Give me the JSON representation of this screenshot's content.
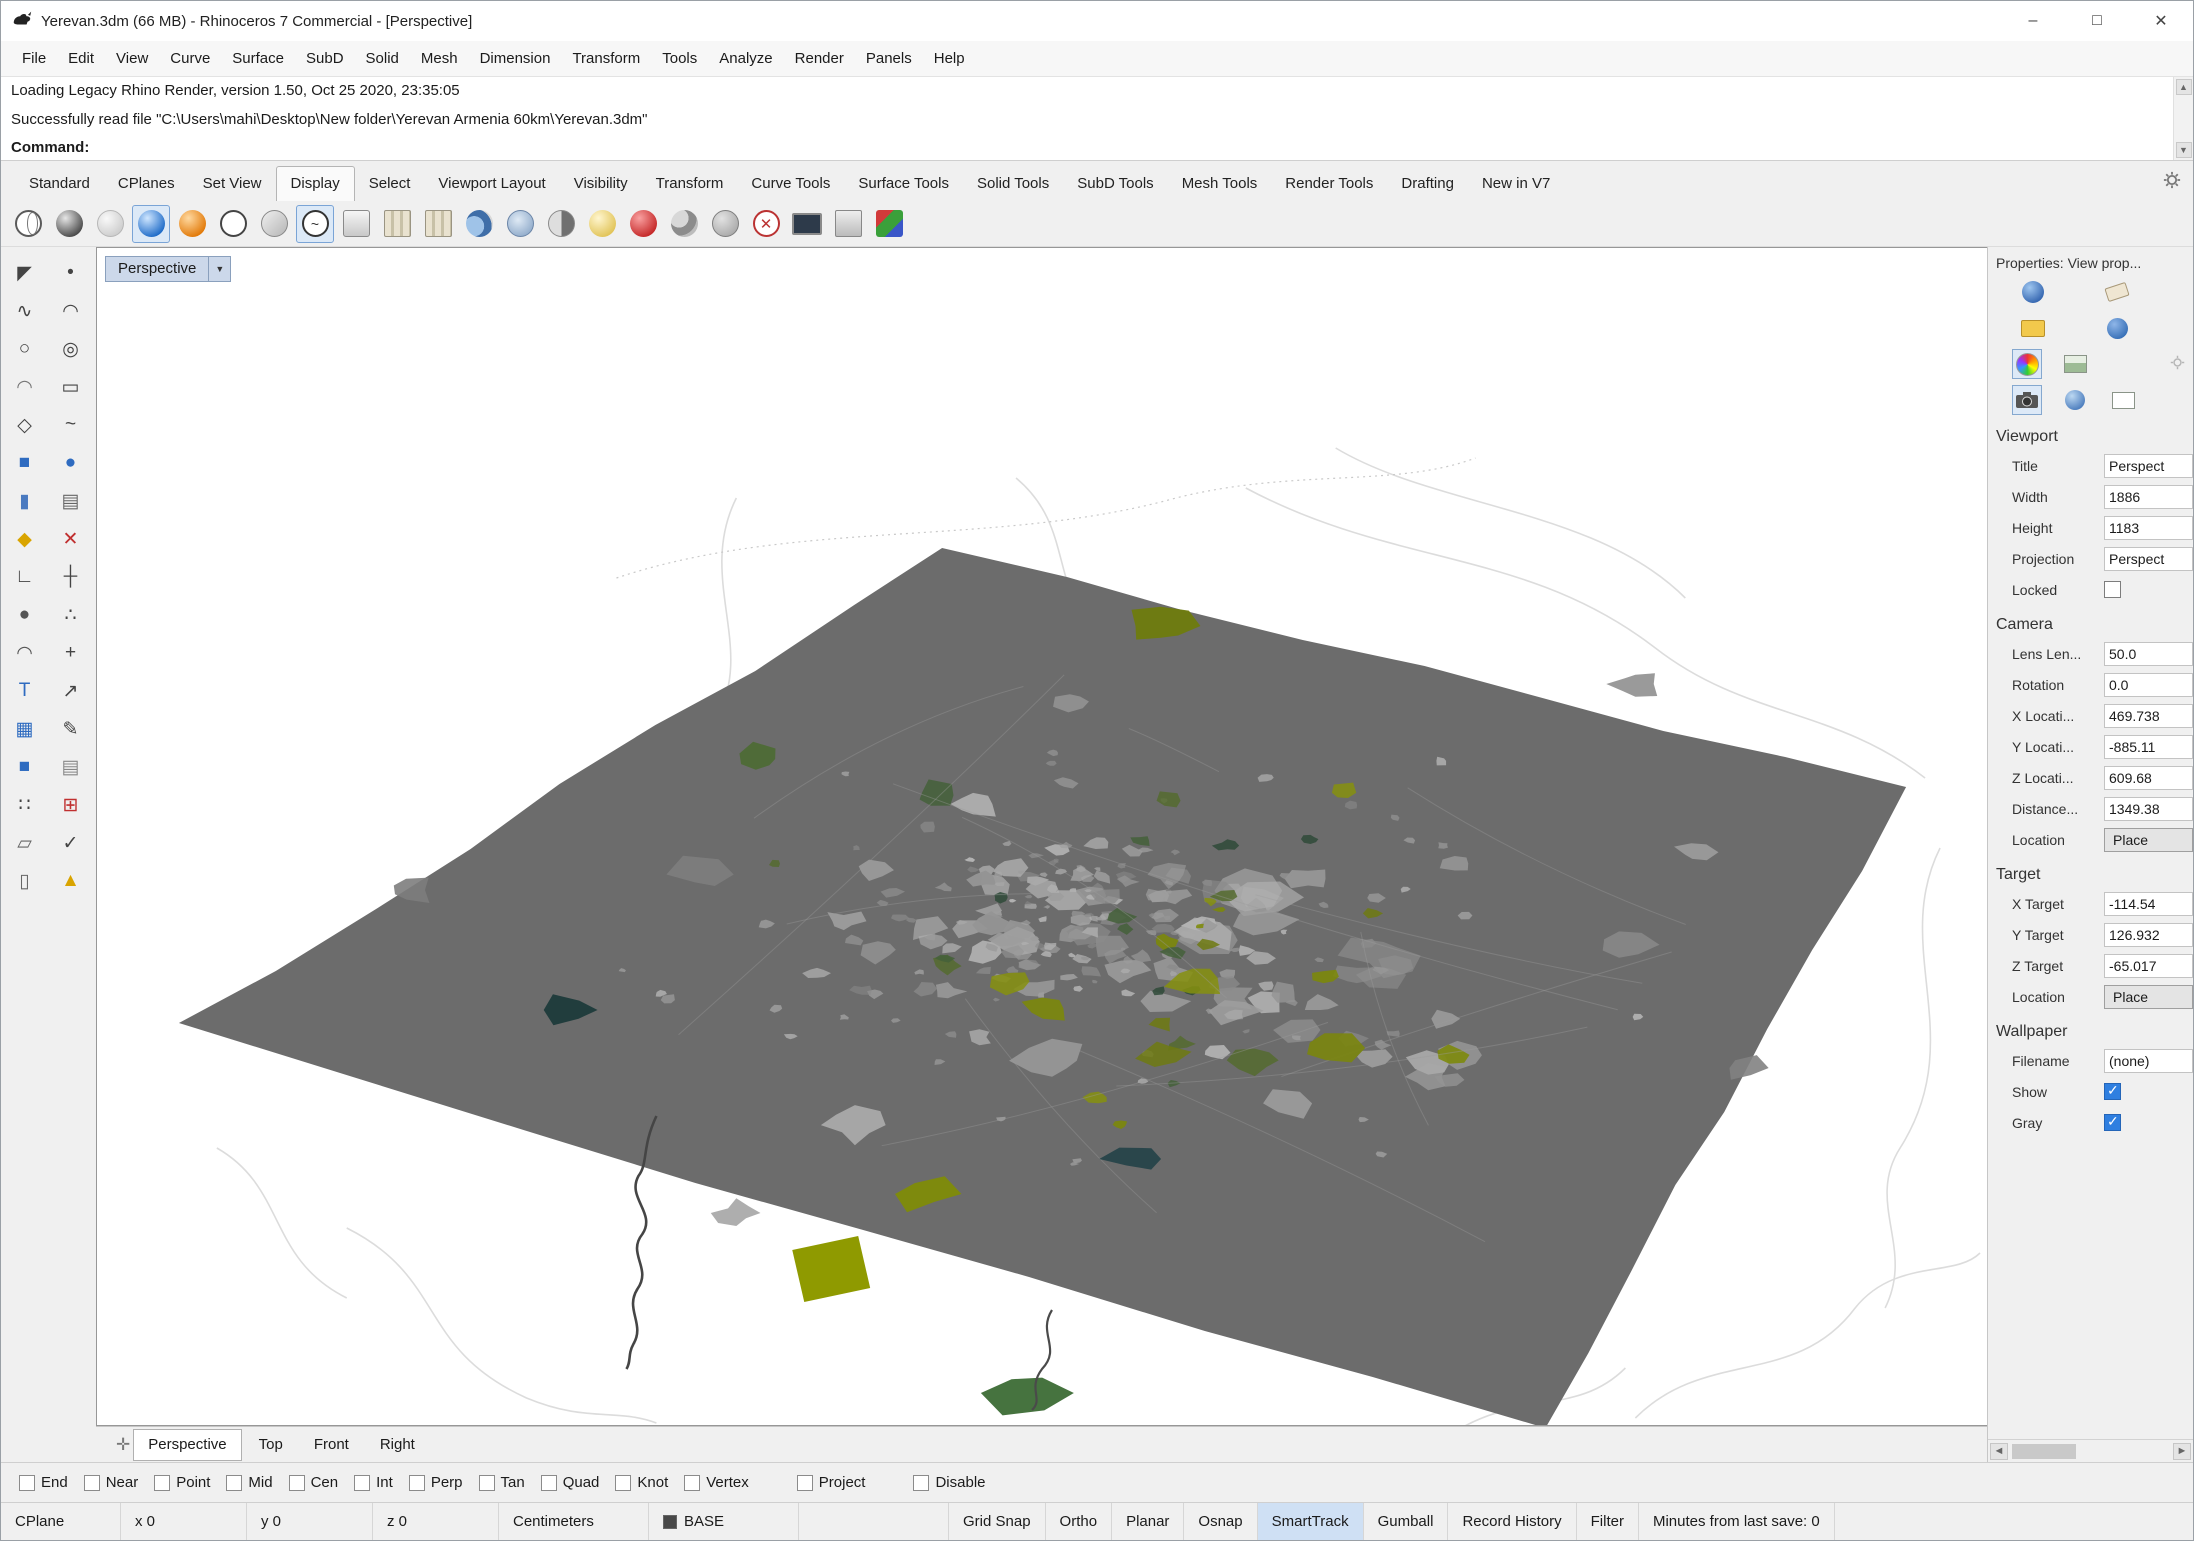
{
  "window": {
    "title": "Yerevan.3dm (66 MB) - Rhinoceros 7 Commercial - [Perspective]"
  },
  "menu": {
    "items": [
      "File",
      "Edit",
      "View",
      "Curve",
      "Surface",
      "SubD",
      "Solid",
      "Mesh",
      "Dimension",
      "Transform",
      "Tools",
      "Analyze",
      "Render",
      "Panels",
      "Help"
    ]
  },
  "command": {
    "line1": "Loading Legacy Rhino Render, version 1.50, Oct 25 2020, 23:35:05",
    "line2": "Successfully read file \"C:\\Users\\mahi\\Desktop\\New folder\\Yerevan Armenia 60km\\Yerevan.3dm\"",
    "prompt": "Command:"
  },
  "tabs": {
    "items": [
      "Standard",
      "CPlanes",
      "Set View",
      "Display",
      "Select",
      "Viewport Layout",
      "Visibility",
      "Transform",
      "Curve Tools",
      "Surface Tools",
      "Solid Tools",
      "SubD Tools",
      "Mesh Tools",
      "Render Tools",
      "Drafting",
      "New in V7"
    ],
    "active": "Display"
  },
  "display_toolbar": {
    "icons": [
      {
        "name": "wireframe-mode-icon",
        "kind": "k-wire"
      },
      {
        "name": "shaded-mode-icon",
        "kind": "k-shaded"
      },
      {
        "name": "ghosted-mode-icon",
        "kind": "k-ghosted"
      },
      {
        "name": "rendered-mode-icon",
        "kind": "k-rendered",
        "pressed": true
      },
      {
        "name": "raytraced-mode-icon",
        "kind": "k-raytraced"
      },
      {
        "name": "technical-mode-icon",
        "kind": "k-technical"
      },
      {
        "name": "artistic-mode-icon",
        "kind": "k-artistic"
      },
      {
        "name": "pen-mode-icon",
        "kind": "k-pen",
        "pressed": true
      },
      {
        "name": "arctic-mode-icon",
        "kind": "k-box"
      },
      {
        "name": "package-display-icon",
        "kind": "k-package"
      },
      {
        "name": "package-alt-display-icon",
        "kind": "k-package"
      },
      {
        "name": "rotate-view-icon",
        "kind": "k-duo"
      },
      {
        "name": "globe-grid-icon",
        "kind": "k-globe"
      },
      {
        "name": "half-shade-icon",
        "kind": "k-half"
      },
      {
        "name": "cream-sphere-icon",
        "kind": "k-cream"
      },
      {
        "name": "clipping-plane-icon",
        "kind": "k-clip"
      },
      {
        "name": "twin-spheres-icon",
        "kind": "k-twin"
      },
      {
        "name": "sphere-arrow-icon",
        "kind": "k-arrow"
      },
      {
        "name": "disable-clipping-icon",
        "kind": "k-xmark"
      },
      {
        "name": "fullscreen-display-icon",
        "kind": "k-monitor"
      },
      {
        "name": "boxes-display-icon",
        "kind": "k-boxes"
      },
      {
        "name": "rgb-cube-icon",
        "kind": "k-rgb"
      }
    ]
  },
  "left_toolbar": {
    "tools": [
      {
        "name": "pointer-tool-icon",
        "glyph": "◤",
        "color": "#444"
      },
      {
        "name": "point-tool-icon",
        "glyph": "•",
        "color": "#444"
      },
      {
        "name": "polyline-tool-icon",
        "glyph": "∿",
        "color": "#444"
      },
      {
        "name": "curve-tool-icon",
        "glyph": "◠",
        "color": "#444"
      },
      {
        "name": "circle-tool-icon",
        "glyph": "○",
        "color": "#444"
      },
      {
        "name": "ellipse-tool-icon",
        "glyph": "◎",
        "color": "#444"
      },
      {
        "name": "arc-tool-icon",
        "glyph": "◠",
        "color": "#777"
      },
      {
        "name": "rectangle-tool-icon",
        "glyph": "▭",
        "color": "#444"
      },
      {
        "name": "polygon-tool-icon",
        "glyph": "◇",
        "color": "#444"
      },
      {
        "name": "freeform-curve-tool-icon",
        "glyph": "~",
        "color": "#444"
      },
      {
        "name": "box-tool-icon",
        "glyph": "■",
        "color": "#2e6bc0"
      },
      {
        "name": "sphere-tool-icon",
        "glyph": "●",
        "color": "#2e6bc0"
      },
      {
        "name": "cylinder-tool-icon",
        "glyph": "▮",
        "color": "#4a7ac0"
      },
      {
        "name": "extrude-tool-icon",
        "glyph": "▤",
        "color": "#666"
      },
      {
        "name": "boolean-tool-icon",
        "glyph": "◆",
        "color": "#d9a400"
      },
      {
        "name": "trim-tool-icon",
        "glyph": "✕",
        "color": "#c03030"
      },
      {
        "name": "orient-tool-icon",
        "glyph": "∟",
        "color": "#444"
      },
      {
        "name": "align-tool-icon",
        "glyph": "┼",
        "color": "#444"
      },
      {
        "name": "shaded-sphere-tool-icon",
        "glyph": "●",
        "color": "#555"
      },
      {
        "name": "point-cloud-tool-icon",
        "glyph": "∴",
        "color": "#444"
      },
      {
        "name": "curve-edit-tool-icon",
        "glyph": "◠",
        "color": "#555"
      },
      {
        "name": "move-tool-icon",
        "glyph": "+",
        "color": "#444"
      },
      {
        "name": "text-tool-icon",
        "glyph": "T",
        "color": "#2e6bc0"
      },
      {
        "name": "scale-tool-icon",
        "glyph": "↗",
        "color": "#444"
      },
      {
        "name": "hatch-tool-icon",
        "glyph": "▦",
        "color": "#2e6bc0"
      },
      {
        "name": "annotate-tool-icon",
        "glyph": "✎",
        "color": "#444"
      },
      {
        "name": "solid-box-tool-icon",
        "glyph": "■",
        "color": "#2e6bc0"
      },
      {
        "name": "surface-tool-icon",
        "glyph": "▤",
        "color": "#888"
      },
      {
        "name": "grid-points-tool-icon",
        "glyph": "∷",
        "color": "#444"
      },
      {
        "name": "grid-tool-icon",
        "glyph": "⊞",
        "color": "#c03030"
      },
      {
        "name": "plane-tool-icon",
        "glyph": "▱",
        "color": "#666"
      },
      {
        "name": "check-tool-icon",
        "glyph": "✓",
        "color": "#444"
      },
      {
        "name": "tube-tool-icon",
        "glyph": "▯",
        "color": "#666"
      },
      {
        "name": "cone-tool-icon",
        "glyph": "▲",
        "color": "#d9a400"
      }
    ]
  },
  "viewport": {
    "title_label": "Perspective"
  },
  "viewport_tabs": {
    "items": [
      "Perspective",
      "Top",
      "Front",
      "Right"
    ],
    "active": "Perspective"
  },
  "props": {
    "header": "Properties: View prop...",
    "viewport_section": {
      "title": "Viewport",
      "rows": [
        {
          "label": "Title",
          "value": "Perspect"
        },
        {
          "label": "Width",
          "value": "1886"
        },
        {
          "label": "Height",
          "value": "1183"
        },
        {
          "label": "Projection",
          "value": "Perspect"
        },
        {
          "label": "Locked",
          "value": "",
          "checked": false
        }
      ]
    },
    "camera_section": {
      "title": "Camera",
      "rows": [
        {
          "label": "Lens Len...",
          "value": "50.0"
        },
        {
          "label": "Rotation",
          "value": "0.0"
        },
        {
          "label": "X Locati...",
          "value": "469.738"
        },
        {
          "label": "Y Locati...",
          "value": "-885.11"
        },
        {
          "label": "Z Locati...",
          "value": "609.68"
        },
        {
          "label": "Distance...",
          "value": "1349.38"
        },
        {
          "label": "Location",
          "value": "Place"
        }
      ]
    },
    "target_section": {
      "title": "Target",
      "rows": [
        {
          "label": "X Target",
          "value": "-114.54"
        },
        {
          "label": "Y Target",
          "value": "126.932"
        },
        {
          "label": "Z Target",
          "value": "-65.017"
        },
        {
          "label": "Location",
          "value": "Place"
        }
      ]
    },
    "wallpaper_section": {
      "title": "Wallpaper",
      "rows": [
        {
          "label": "Filename",
          "value": "(none)"
        },
        {
          "label": "Show",
          "value": "",
          "checked": true
        },
        {
          "label": "Gray",
          "value": "",
          "checked": true
        }
      ]
    }
  },
  "osnap": {
    "snaps": [
      "End",
      "Near",
      "Point",
      "Mid",
      "Cen",
      "Int",
      "Perp",
      "Tan",
      "Quad",
      "Knot",
      "Vertex"
    ],
    "project": "Project",
    "disable": "Disable"
  },
  "status": {
    "cplane": "CPlane",
    "x": "x 0",
    "y": "y 0",
    "z": "z 0",
    "units": "Centimeters",
    "layer": "BASE",
    "panes": [
      "Grid Snap",
      "Ortho",
      "Planar",
      "Osnap",
      "SmartTrack",
      "Gumball",
      "Record History",
      "Filter"
    ],
    "active_pane": "SmartTrack",
    "message": "Minutes from last save: 0"
  }
}
